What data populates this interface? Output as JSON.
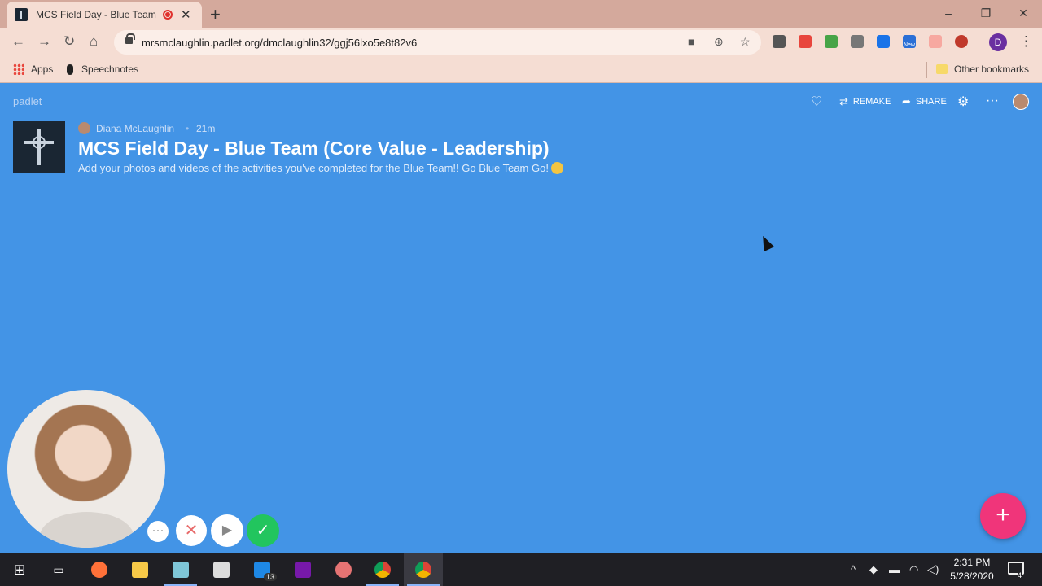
{
  "browser": {
    "tab_title": "MCS Field Day - Blue Team (",
    "new_tab": "+",
    "window_controls": {
      "minimize": "–",
      "restore": "❐",
      "close": "✕"
    },
    "url": "mrsmclaughlin.padlet.org/dmclaughlin32/ggj56lxo5e8t82v6",
    "profile_initial": "D",
    "extension_badge": "New",
    "bookmarks": {
      "apps": "Apps",
      "speechnotes": "Speechnotes",
      "other": "Other bookmarks"
    }
  },
  "padlet": {
    "logo": "padlet",
    "actions": {
      "remake": "REMAKE",
      "share": "SHARE"
    },
    "author": "Diana McLaughlin",
    "time_ago": "21m",
    "title": "MCS Field Day - Blue Team (Core Value - Leadership)",
    "description": "Add your photos and videos of the activities you've completed for the Blue Team!! Go Blue Team Go!",
    "fab": "+"
  },
  "recorder": {
    "more": "···",
    "cancel": "✕",
    "pause": "▶",
    "done": "✓"
  },
  "taskbar": {
    "mail_badge": "13",
    "clock_time": "2:31 PM",
    "clock_date": "5/28/2020",
    "notification_count": "4"
  },
  "colors": {
    "page_bg": "#4394e6",
    "chrome": "#f5ddd3",
    "fab": "#f0357a",
    "taskbar": "#1f1f24"
  }
}
